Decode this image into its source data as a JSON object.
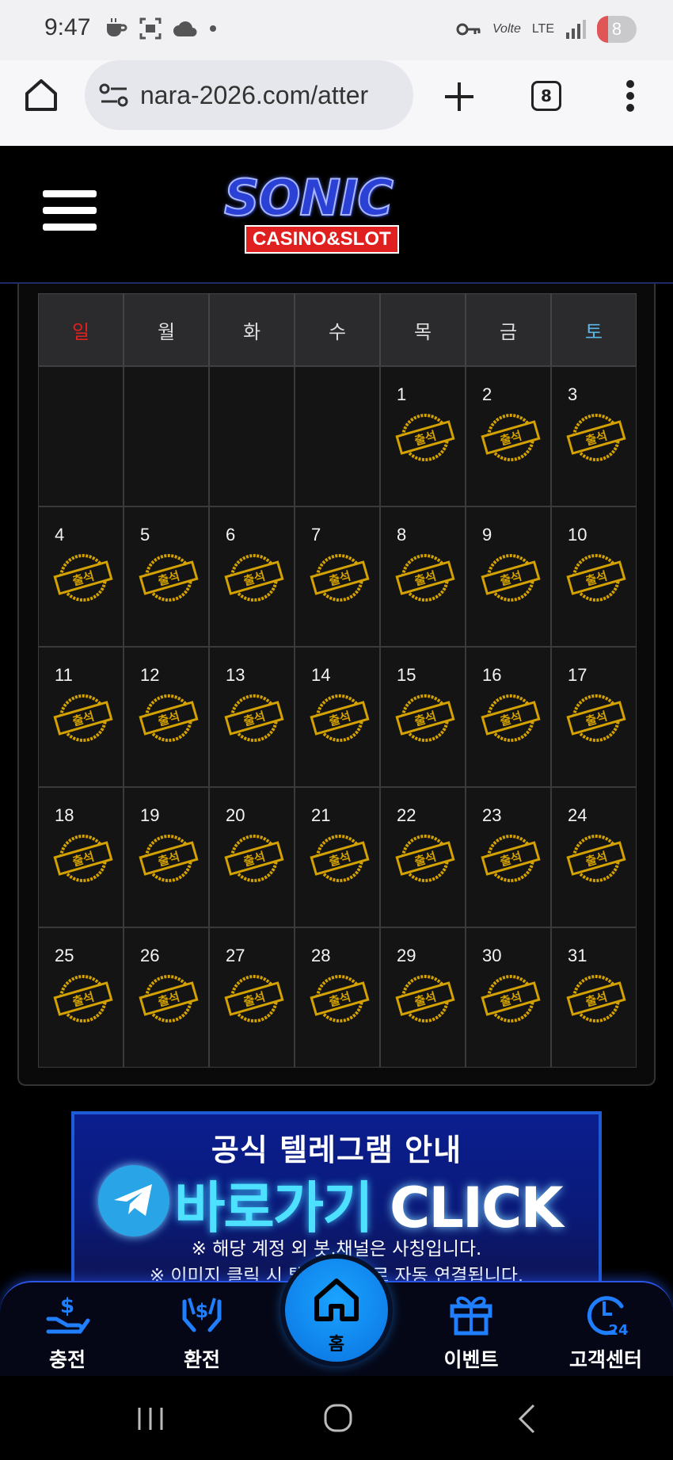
{
  "status_bar": {
    "time": "9:47",
    "network": "LTE",
    "volte": "Volte",
    "battery": "8"
  },
  "browser": {
    "url": "nara-2026.com/atter",
    "tab_count": "8"
  },
  "header": {
    "logo_title": "SONIC",
    "logo_subtitle": "CASINO&SLOT"
  },
  "calendar": {
    "weekdays": [
      "일",
      "월",
      "화",
      "수",
      "목",
      "금",
      "토"
    ],
    "leading_blanks": 4,
    "days": [
      {
        "day": "1",
        "stamp": "출석"
      },
      {
        "day": "2",
        "stamp": "출석"
      },
      {
        "day": "3",
        "stamp": "출석"
      },
      {
        "day": "4",
        "stamp": "출석"
      },
      {
        "day": "5",
        "stamp": "출석"
      },
      {
        "day": "6",
        "stamp": "출석"
      },
      {
        "day": "7",
        "stamp": "출석"
      },
      {
        "day": "8",
        "stamp": "출석"
      },
      {
        "day": "9",
        "stamp": "출석"
      },
      {
        "day": "10",
        "stamp": "출석"
      },
      {
        "day": "11",
        "stamp": "출석"
      },
      {
        "day": "12",
        "stamp": "출석"
      },
      {
        "day": "13",
        "stamp": "출석"
      },
      {
        "day": "14",
        "stamp": "출석"
      },
      {
        "day": "15",
        "stamp": "출석"
      },
      {
        "day": "16",
        "stamp": "출석"
      },
      {
        "day": "17",
        "stamp": "출석"
      },
      {
        "day": "18",
        "stamp": "출석"
      },
      {
        "day": "19",
        "stamp": "출석"
      },
      {
        "day": "20",
        "stamp": "출석"
      },
      {
        "day": "21",
        "stamp": "출석"
      },
      {
        "day": "22",
        "stamp": "출석"
      },
      {
        "day": "23",
        "stamp": "출석"
      },
      {
        "day": "24",
        "stamp": "출석"
      },
      {
        "day": "25",
        "stamp": "출석"
      },
      {
        "day": "26",
        "stamp": "출석"
      },
      {
        "day": "27",
        "stamp": "출석"
      },
      {
        "day": "28",
        "stamp": "출석"
      },
      {
        "day": "29",
        "stamp": "출석"
      },
      {
        "day": "30",
        "stamp": "출석"
      },
      {
        "day": "31",
        "stamp": "출석"
      }
    ],
    "colors": {
      "sunday": "#e12020",
      "saturday": "#5ab7e8",
      "stamp": "#d4a200"
    }
  },
  "telegram_banner": {
    "title": "공식 텔레그램 안내",
    "cta_text": "바로가기",
    "cta_click": "CLICK",
    "note1": "※ 해당 계정 외 봇,채널은 사칭입니다.",
    "note2": "※ 이미지 클릭 시 텔레그램으로 자동 연결됩니다."
  },
  "bottom_nav": {
    "charge": "충전",
    "exchange": "환전",
    "home": "홈",
    "event": "이벤트",
    "support": "고객센터",
    "support_badge": "24"
  }
}
